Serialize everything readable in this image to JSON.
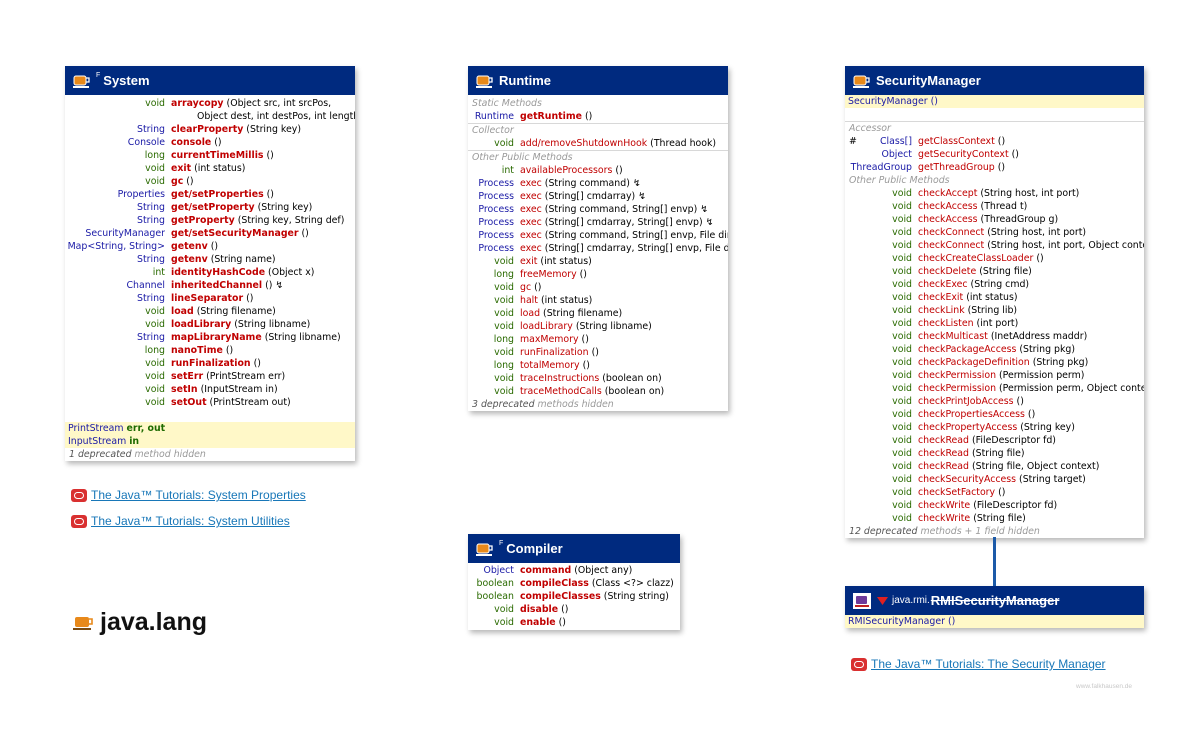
{
  "package_title": "java.lang",
  "watermark": "www.falkhausen.de",
  "system": {
    "title": "System",
    "final_mark": "F",
    "rows": [
      {
        "type": "void",
        "name": "arraycopy",
        "params": "(Object src, int srcPos,"
      },
      {
        "type": "",
        "name": "",
        "params": "Object dest, int destPos, int length)"
      },
      {
        "type": "String",
        "name": "clearProperty",
        "params": "(String key)"
      },
      {
        "type": "Console",
        "name": "console",
        "params": "()"
      },
      {
        "type": "long",
        "name": "currentTimeMillis",
        "params": "()"
      },
      {
        "type": "void",
        "name": "exit",
        "params": "(int status)"
      },
      {
        "type": "void",
        "name": "gc",
        "params": "()"
      },
      {
        "type": "Properties",
        "name": "get/setProperties",
        "params": "()"
      },
      {
        "type": "String",
        "name": "get/setProperty",
        "params": "(String key)"
      },
      {
        "type": "String",
        "name": "getProperty",
        "params": "(String key, String def)"
      },
      {
        "type": "SecurityManager",
        "name": "get/setSecurityManager",
        "params": "()"
      },
      {
        "type": "Map<String, String>",
        "name": "getenv",
        "params": "()"
      },
      {
        "type": "String",
        "name": "getenv",
        "params": "(String name)"
      },
      {
        "type": "int",
        "name": "identityHashCode",
        "params": "(Object x)"
      },
      {
        "type": "Channel",
        "name": "inheritedChannel",
        "params": "() ↯"
      },
      {
        "type": "String",
        "name": "lineSeparator",
        "params": "()"
      },
      {
        "type": "void",
        "name": "load",
        "params": "(String filename)"
      },
      {
        "type": "void",
        "name": "loadLibrary",
        "params": "(String libname)"
      },
      {
        "type": "String",
        "name": "mapLibraryName",
        "params": "(String libname)"
      },
      {
        "type": "long",
        "name": "nanoTime",
        "params": "()"
      },
      {
        "type": "void",
        "name": "runFinalization",
        "params": "()"
      },
      {
        "type": "void",
        "name": "setErr",
        "params": "(PrintStream err)"
      },
      {
        "type": "void",
        "name": "setIn",
        "params": "(InputStream in)"
      },
      {
        "type": "void",
        "name": "setOut",
        "params": "(PrintStream out)"
      }
    ],
    "fields": [
      {
        "type": "PrintStream",
        "names": "err, out"
      },
      {
        "type": "InputStream",
        "names": "in"
      }
    ],
    "footer_count": "1 deprecated",
    "footer_text": "method hidden"
  },
  "runtime": {
    "title": "Runtime",
    "section_static": "Static Methods",
    "section_collector": "Collector",
    "section_other": "Other Public Methods",
    "static_rows": [
      {
        "type": "Runtime",
        "name": "getRuntime",
        "params": "()"
      }
    ],
    "collector_rows": [
      {
        "type": "void",
        "name": "add/removeShutdownHook",
        "params": "(Thread hook)"
      }
    ],
    "other_rows": [
      {
        "type": "int",
        "name": "availableProcessors",
        "params": "()"
      },
      {
        "type": "Process",
        "name": "exec",
        "params": "(String command) ↯"
      },
      {
        "type": "Process",
        "name": "exec",
        "params": "(String[] cmdarray) ↯"
      },
      {
        "type": "Process",
        "name": "exec",
        "params": "(String command, String[] envp) ↯"
      },
      {
        "type": "Process",
        "name": "exec",
        "params": "(String[] cmdarray, String[] envp) ↯"
      },
      {
        "type": "Process",
        "name": "exec",
        "params": "(String command, String[] envp, File dir) ↯"
      },
      {
        "type": "Process",
        "name": "exec",
        "params": "(String[] cmdarray, String[] envp, File dir) ↯"
      },
      {
        "type": "void",
        "name": "exit",
        "params": "(int status)"
      },
      {
        "type": "long",
        "name": "freeMemory",
        "params": "()"
      },
      {
        "type": "void",
        "name": "gc",
        "params": "()"
      },
      {
        "type": "void",
        "name": "halt",
        "params": "(int status)"
      },
      {
        "type": "void",
        "name": "load",
        "params": "(String filename)"
      },
      {
        "type": "void",
        "name": "loadLibrary",
        "params": "(String libname)"
      },
      {
        "type": "long",
        "name": "maxMemory",
        "params": "()"
      },
      {
        "type": "void",
        "name": "runFinalization",
        "params": "()"
      },
      {
        "type": "long",
        "name": "totalMemory",
        "params": "()"
      },
      {
        "type": "void",
        "name": "traceInstructions",
        "params": "(boolean on)"
      },
      {
        "type": "void",
        "name": "traceMethodCalls",
        "params": "(boolean on)"
      }
    ],
    "footer_count": "3 deprecated",
    "footer_text": "methods hidden"
  },
  "compiler": {
    "title": "Compiler",
    "final_mark": "F",
    "rows": [
      {
        "type": "Object",
        "name": "command",
        "params": "(Object any)"
      },
      {
        "type": "boolean",
        "name": "compileClass",
        "params": "(Class <?> clazz)"
      },
      {
        "type": "boolean",
        "name": "compileClasses",
        "params": "(String string)"
      },
      {
        "type": "void",
        "name": "disable",
        "params": "()"
      },
      {
        "type": "void",
        "name": "enable",
        "params": "()"
      }
    ]
  },
  "security_manager": {
    "title": "SecurityManager",
    "constructor": "SecurityManager ()",
    "section_accessor": "Accessor",
    "section_other": "Other Public Methods",
    "accessor_rows": [
      {
        "type": "Class[]",
        "name": "getClassContext",
        "params": "()",
        "prefix": "#"
      },
      {
        "type": "Object",
        "name": "getSecurityContext",
        "params": "()",
        "prefix": ""
      },
      {
        "type": "ThreadGroup",
        "name": "getThreadGroup",
        "params": "()",
        "prefix": ""
      }
    ],
    "other_rows": [
      {
        "type": "void",
        "name": "checkAccept",
        "params": "(String host, int port)"
      },
      {
        "type": "void",
        "name": "checkAccess",
        "params": "(Thread t)"
      },
      {
        "type": "void",
        "name": "checkAccess",
        "params": "(ThreadGroup g)"
      },
      {
        "type": "void",
        "name": "checkConnect",
        "params": "(String host, int port)"
      },
      {
        "type": "void",
        "name": "checkConnect",
        "params": "(String host, int port, Object context)"
      },
      {
        "type": "void",
        "name": "checkCreateClassLoader",
        "params": "()"
      },
      {
        "type": "void",
        "name": "checkDelete",
        "params": "(String file)"
      },
      {
        "type": "void",
        "name": "checkExec",
        "params": "(String cmd)"
      },
      {
        "type": "void",
        "name": "checkExit",
        "params": "(int status)"
      },
      {
        "type": "void",
        "name": "checkLink",
        "params": "(String lib)"
      },
      {
        "type": "void",
        "name": "checkListen",
        "params": "(int port)"
      },
      {
        "type": "void",
        "name": "checkMulticast",
        "params": "(InetAddress maddr)"
      },
      {
        "type": "void",
        "name": "checkPackageAccess",
        "params": "(String pkg)"
      },
      {
        "type": "void",
        "name": "checkPackageDefinition",
        "params": "(String pkg)"
      },
      {
        "type": "void",
        "name": "checkPermission",
        "params": "(Permission perm)"
      },
      {
        "type": "void",
        "name": "checkPermission",
        "params": "(Permission perm, Object context)"
      },
      {
        "type": "void",
        "name": "checkPrintJobAccess",
        "params": "()"
      },
      {
        "type": "void",
        "name": "checkPropertiesAccess",
        "params": "()"
      },
      {
        "type": "void",
        "name": "checkPropertyAccess",
        "params": "(String key)"
      },
      {
        "type": "void",
        "name": "checkRead",
        "params": "(FileDescriptor fd)"
      },
      {
        "type": "void",
        "name": "checkRead",
        "params": "(String file)"
      },
      {
        "type": "void",
        "name": "checkRead",
        "params": "(String file, Object context)"
      },
      {
        "type": "void",
        "name": "checkSecurityAccess",
        "params": "(String target)"
      },
      {
        "type": "void",
        "name": "checkSetFactory",
        "params": "()"
      },
      {
        "type": "void",
        "name": "checkWrite",
        "params": "(FileDescriptor fd)"
      },
      {
        "type": "void",
        "name": "checkWrite",
        "params": "(String file)"
      }
    ],
    "footer_count": "12 deprecated",
    "footer_text": "methods + 1 field hidden"
  },
  "rmi_security_manager": {
    "package": "java.rmi.",
    "title": "RMISecurityManager",
    "constructor": "RMISecurityManager ()"
  },
  "links": {
    "system_properties": "The Java™ Tutorials: System Properties",
    "system_utilities": "The Java™ Tutorials: System Utilities",
    "security_manager": "The Java™ Tutorials: The Security Manager"
  },
  "colors": {
    "header": "#002a7f",
    "method": "#c00000",
    "type": "#1a1aa6",
    "primitive": "#2a6a00",
    "highlight": "#fff8c8",
    "connector": "#1c5aa8"
  }
}
